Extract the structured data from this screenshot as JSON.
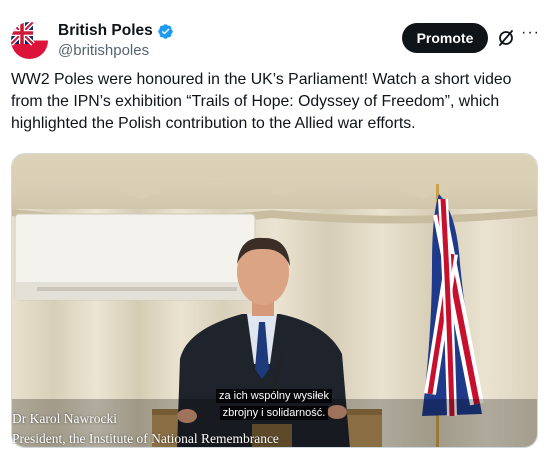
{
  "author": {
    "display_name": "British Poles",
    "handle": "@britishpoles",
    "avatar_icon": "union-jack-polish-flag-avatar",
    "verified_icon": "verified-badge-icon",
    "verified_color": "#1d9bf0"
  },
  "actions": {
    "promote_label": "Promote",
    "grok_icon": "grok-icon",
    "more_icon": "more-icon"
  },
  "tweet": {
    "text": "WW2 Poles were honoured in the UK’s Parliament! Watch a short video from the IPN’s exhibition “Trails of Hope: Odyssey of Freedom”, which highlighted the Polish contribution to the Allied war efforts."
  },
  "video": {
    "subtitle_line1": "za ich wspólny wysiłek",
    "subtitle_line2": "zbrojny i solidarność.",
    "speaker_name": "Dr Karol Nawrocki",
    "speaker_title": "President, the Institute of National Remembrance"
  },
  "colors": {
    "promote_bg": "#0f1419",
    "text": "#0f1419",
    "secondary_text": "#536471"
  }
}
